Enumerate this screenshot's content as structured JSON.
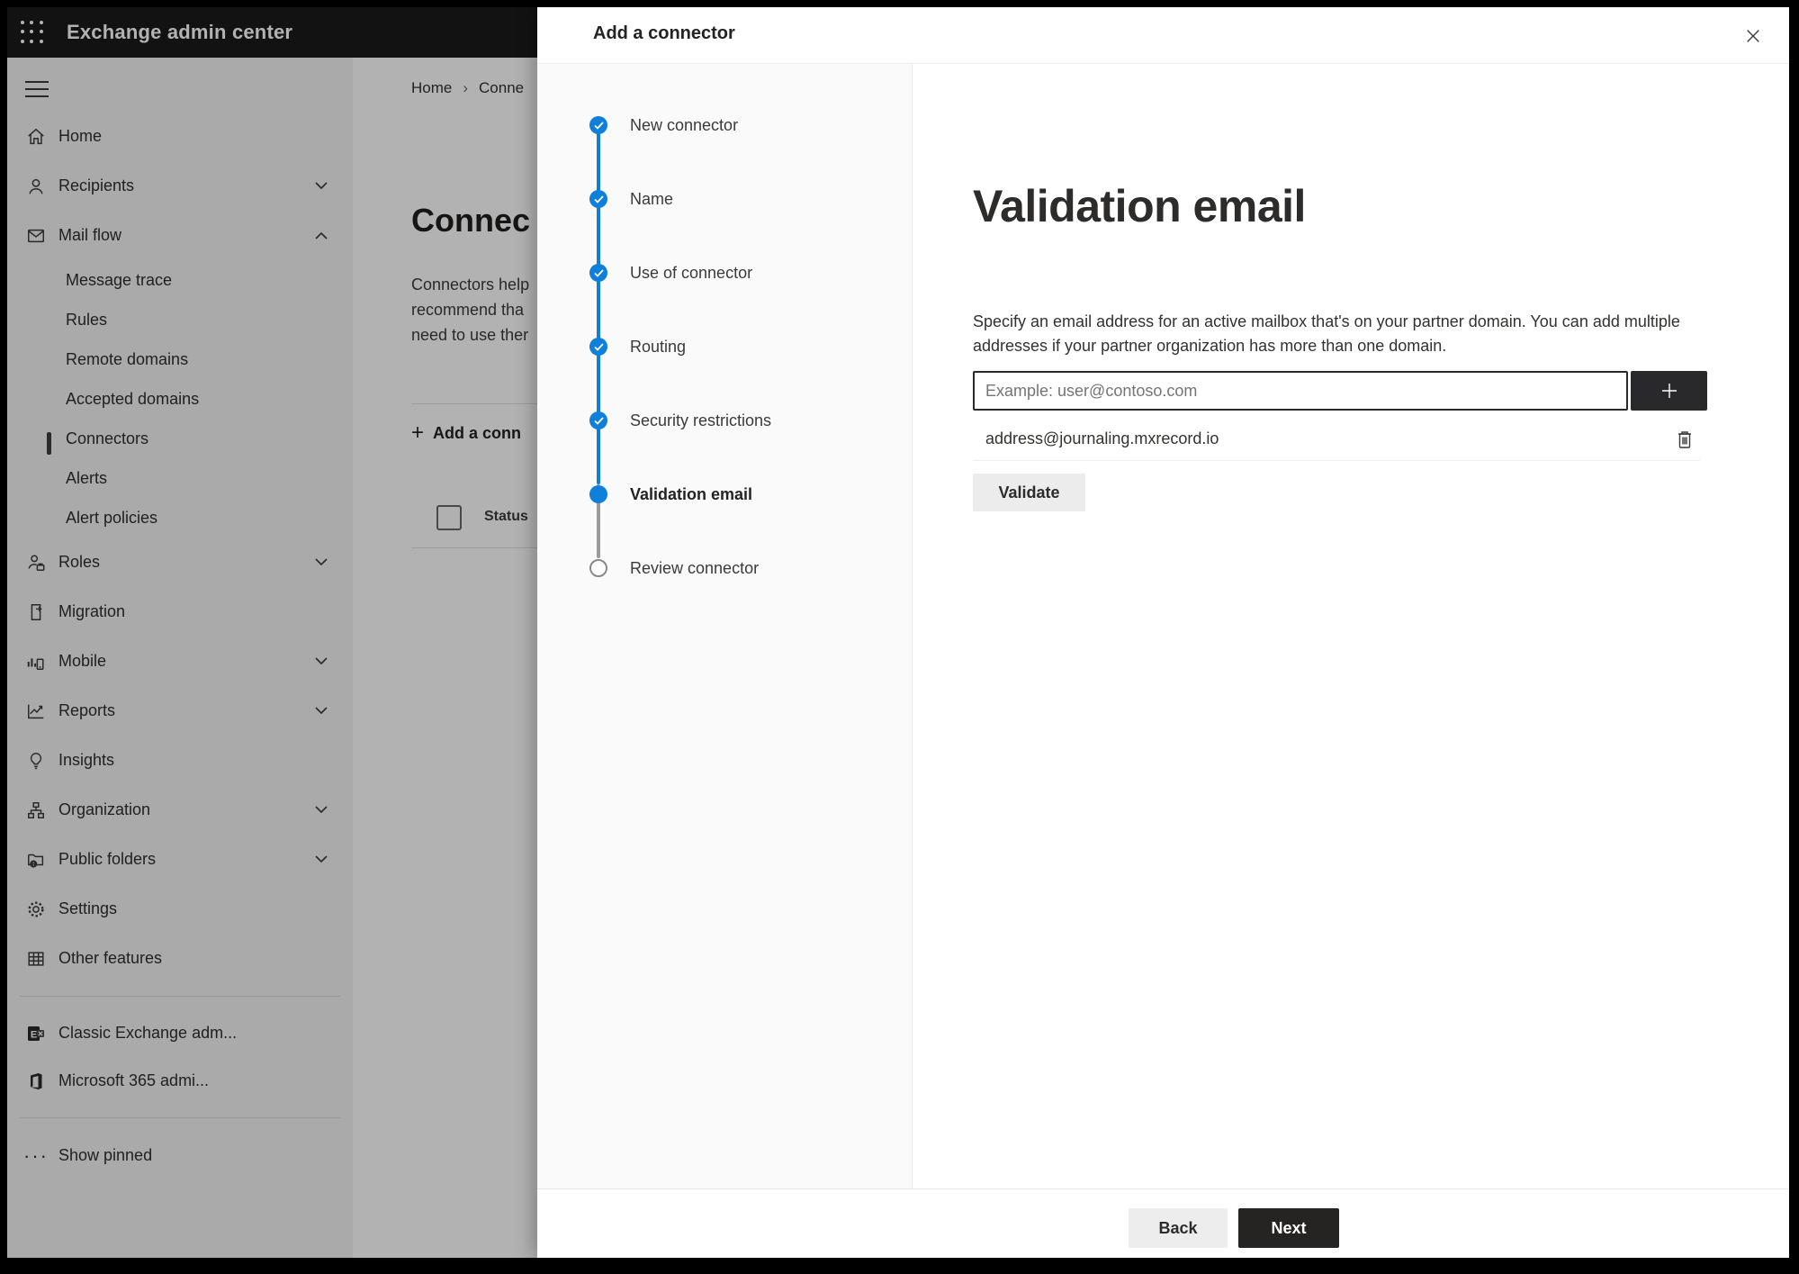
{
  "topbar": {
    "title": "Exchange admin center"
  },
  "sidebar": {
    "items": [
      {
        "label": "Home",
        "icon": "home-icon",
        "chevron": null
      },
      {
        "label": "Recipients",
        "icon": "person-icon",
        "chevron": "down"
      },
      {
        "label": "Mail flow",
        "icon": "mail-icon",
        "chevron": "up"
      },
      {
        "label": "Message trace"
      },
      {
        "label": "Rules"
      },
      {
        "label": "Remote domains"
      },
      {
        "label": "Accepted domains"
      },
      {
        "label": "Connectors",
        "selected": true
      },
      {
        "label": "Alerts"
      },
      {
        "label": "Alert policies"
      },
      {
        "label": "Roles",
        "icon": "roles-icon",
        "chevron": "down"
      },
      {
        "label": "Migration",
        "icon": "migration-icon",
        "chevron": null
      },
      {
        "label": "Mobile",
        "icon": "mobile-icon",
        "chevron": "down"
      },
      {
        "label": "Reports",
        "icon": "reports-icon",
        "chevron": "down"
      },
      {
        "label": "Insights",
        "icon": "lightbulb-icon",
        "chevron": null
      },
      {
        "label": "Organization",
        "icon": "org-tree-icon",
        "chevron": "down"
      },
      {
        "label": "Public folders",
        "icon": "folder-globe-icon",
        "chevron": "down"
      },
      {
        "label": "Settings",
        "icon": "gear-icon",
        "chevron": null
      },
      {
        "label": "Other features",
        "icon": "grid-icon",
        "chevron": null
      },
      {
        "label": "Classic Exchange adm...",
        "icon": "exchange-logo-icon"
      },
      {
        "label": "Microsoft 365 admi...",
        "icon": "office-logo-icon"
      },
      {
        "label": "Show pinned",
        "icon": "ellipsis-icon"
      }
    ]
  },
  "background_page": {
    "breadcrumb": {
      "home": "Home",
      "current": "Conne"
    },
    "title_fragment": "Connec",
    "body_lines": "Connectors help\nrecommend tha\nneed to use ther",
    "add_connector_fragment": "Add a conn",
    "table_header_status": "Status"
  },
  "panel": {
    "title": "Add a connector",
    "steps": [
      {
        "label": "New connector",
        "state": "done"
      },
      {
        "label": "Name",
        "state": "done"
      },
      {
        "label": "Use of connector",
        "state": "done"
      },
      {
        "label": "Routing",
        "state": "done"
      },
      {
        "label": "Security restrictions",
        "state": "done"
      },
      {
        "label": "Validation email",
        "state": "current"
      },
      {
        "label": "Review connector",
        "state": "todo"
      }
    ],
    "page": {
      "title": "Validation email",
      "description": "Specify an email address for an active mailbox that's on your partner domain. You can add multiple addresses if your partner organization has more than one domain.",
      "input_placeholder": "Example: user@contoso.com",
      "added_address": "address@journaling.mxrecord.io",
      "validate_label": "Validate"
    },
    "footer": {
      "back_label": "Back",
      "next_label": "Next"
    }
  },
  "colors": {
    "accent_blue": "#0e7fdb",
    "topbar_bg": "#1a1a1a",
    "primary_button_bg": "#252423",
    "neutral_button_bg": "#ededed",
    "overlay": "rgba(0,0,0,0.30)"
  }
}
